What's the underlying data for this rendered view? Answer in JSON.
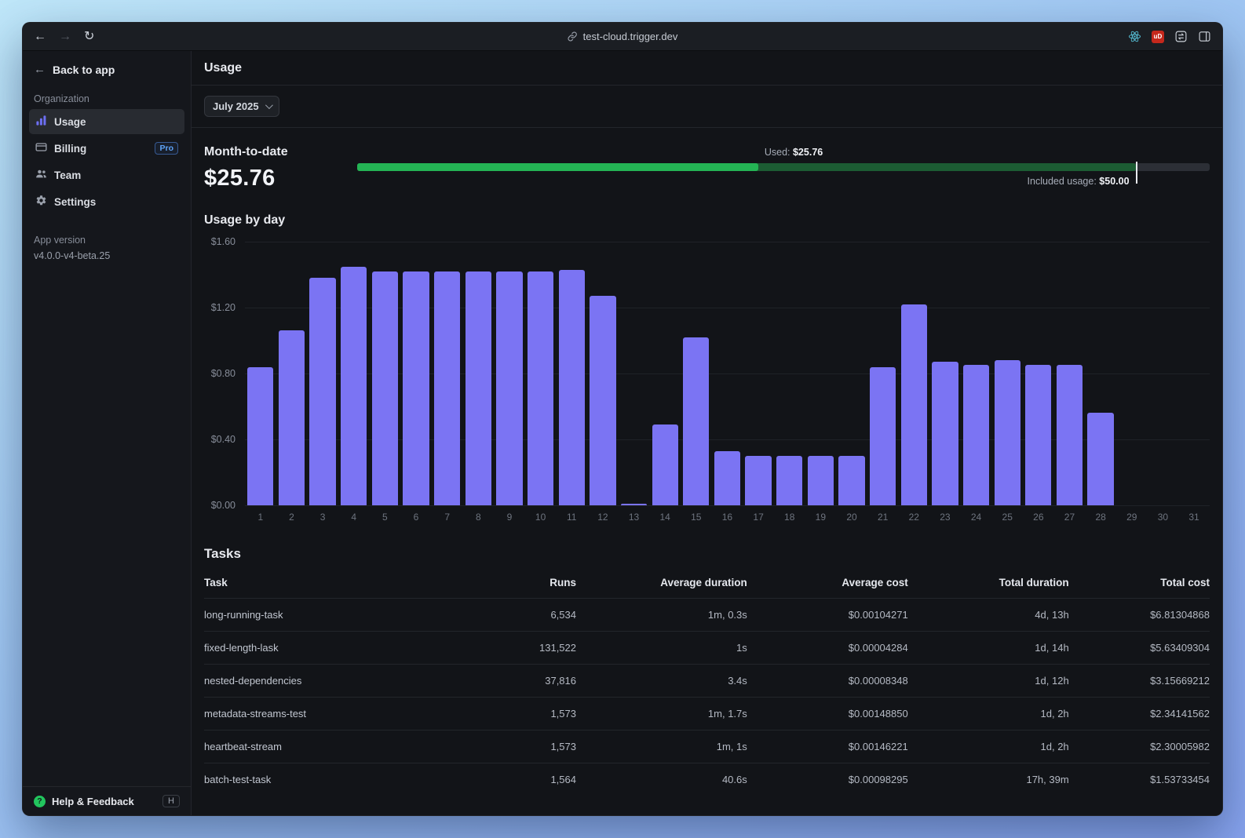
{
  "browser": {
    "url": "test-cloud.trigger.dev",
    "back": "←",
    "forward": "→",
    "reload": "↻",
    "extension_badge": "uD"
  },
  "sidebar": {
    "back_label": "Back to app",
    "section_label": "Organization",
    "items": [
      {
        "label": "Usage"
      },
      {
        "label": "Billing",
        "badge": "Pro"
      },
      {
        "label": "Team"
      },
      {
        "label": "Settings"
      }
    ],
    "app_version_label": "App version",
    "app_version_value": "v4.0.0-v4-beta.25",
    "help_label": "Help & Feedback",
    "help_shortcut": "H"
  },
  "header": {
    "title": "Usage"
  },
  "filter": {
    "month_selector": "July 2025"
  },
  "month_to_date": {
    "title": "Month-to-date",
    "amount": "$25.76",
    "used_label": "Used:",
    "used_value": "$25.76",
    "included_label": "Included usage:",
    "included_value": "$50.00",
    "used": 25.76,
    "included": 50.0,
    "used_color": "#24b454",
    "included_color": "#1c5c33"
  },
  "chart_data": {
    "type": "bar",
    "title": "Usage by day",
    "x": [
      "1",
      "2",
      "3",
      "4",
      "5",
      "6",
      "7",
      "8",
      "9",
      "10",
      "11",
      "12",
      "13",
      "14",
      "15",
      "16",
      "17",
      "18",
      "19",
      "20",
      "21",
      "22",
      "23",
      "24",
      "25",
      "26",
      "27",
      "28",
      "29",
      "30",
      "31"
    ],
    "values": [
      0.84,
      1.06,
      1.38,
      1.45,
      1.42,
      1.42,
      1.42,
      1.42,
      1.42,
      1.42,
      1.43,
      1.27,
      0.01,
      0.49,
      1.02,
      0.33,
      0.3,
      0.3,
      0.3,
      0.3,
      0.84,
      1.22,
      0.87,
      0.85,
      0.88,
      0.85,
      0.85,
      0.56,
      0,
      0,
      0
    ],
    "yticks": [
      "$1.60",
      "$1.20",
      "$0.80",
      "$0.40",
      "$0.00"
    ],
    "ylim": [
      0,
      1.6
    ],
    "xlabel": "",
    "ylabel": "",
    "grid": true,
    "legend": false,
    "bar_color": "#7b74f3"
  },
  "tasks": {
    "title": "Tasks",
    "columns": [
      "Task",
      "Runs",
      "Average duration",
      "Average cost",
      "Total duration",
      "Total cost"
    ],
    "rows": [
      [
        "long-running-task",
        "6,534",
        "1m, 0.3s",
        "$0.00104271",
        "4d, 13h",
        "$6.81304868"
      ],
      [
        "fixed-length-lask",
        "131,522",
        "1s",
        "$0.00004284",
        "1d, 14h",
        "$5.63409304"
      ],
      [
        "nested-dependencies",
        "37,816",
        "3.4s",
        "$0.00008348",
        "1d, 12h",
        "$3.15669212"
      ],
      [
        "metadata-streams-test",
        "1,573",
        "1m, 1.7s",
        "$0.00148850",
        "1d, 2h",
        "$2.34141562"
      ],
      [
        "heartbeat-stream",
        "1,573",
        "1m, 1s",
        "$0.00146221",
        "1d, 2h",
        "$2.30005982"
      ],
      [
        "batch-test-task",
        "1,564",
        "40.6s",
        "$0.00098295",
        "17h, 39m",
        "$1.53733454"
      ]
    ]
  }
}
